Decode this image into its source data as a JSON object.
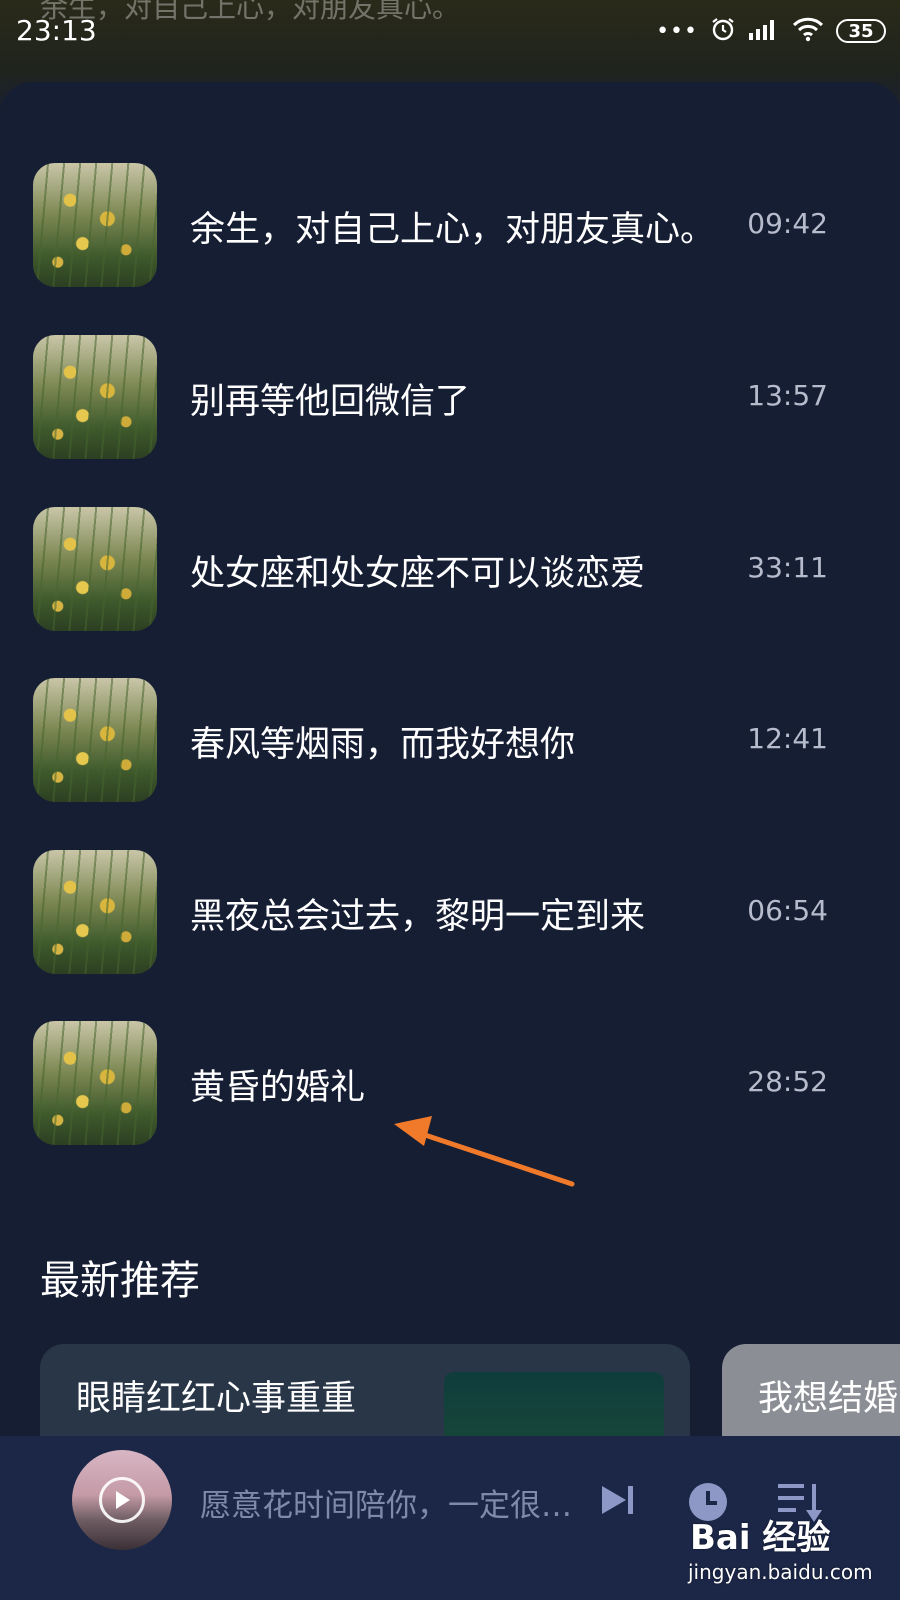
{
  "status_bar": {
    "time": "23:13",
    "dots": "•••",
    "battery": "35",
    "icons": [
      "alarm-icon",
      "signal-icon",
      "wifi-icon",
      "battery-icon"
    ]
  },
  "background_text": "余生，对自己上心，对朋友真心。",
  "tracks": [
    {
      "title": "余生，对自己上心，对朋友真心。",
      "duration": "09:42"
    },
    {
      "title": "别再等他回微信了",
      "duration": "13:57"
    },
    {
      "title": "处女座和处女座不可以谈恋爱",
      "duration": "33:11"
    },
    {
      "title": "春风等烟雨，而我好想你",
      "duration": "12:41"
    },
    {
      "title": "黑夜总会过去，黎明一定到来",
      "duration": "06:54"
    },
    {
      "title": "黄昏的婚礼",
      "duration": "28:52"
    }
  ],
  "recommend": {
    "section_title": "最新推荐",
    "cards": [
      {
        "title": "眼睛红红心事重重"
      },
      {
        "title": "我想结婚"
      }
    ]
  },
  "player": {
    "now_playing": "愿意花时间陪你，一定很爱你",
    "icons": [
      "play-icon",
      "next-track-icon",
      "timer-icon",
      "playlist-icon"
    ]
  },
  "watermark": {
    "logo": "Bai 经验",
    "url": "jingyan.baidu.com"
  },
  "colors": {
    "background": "#161e34",
    "player_bar": "#1c2748",
    "annotation_arrow": "#f07a2a",
    "secondary_text": "#b6bccb"
  }
}
